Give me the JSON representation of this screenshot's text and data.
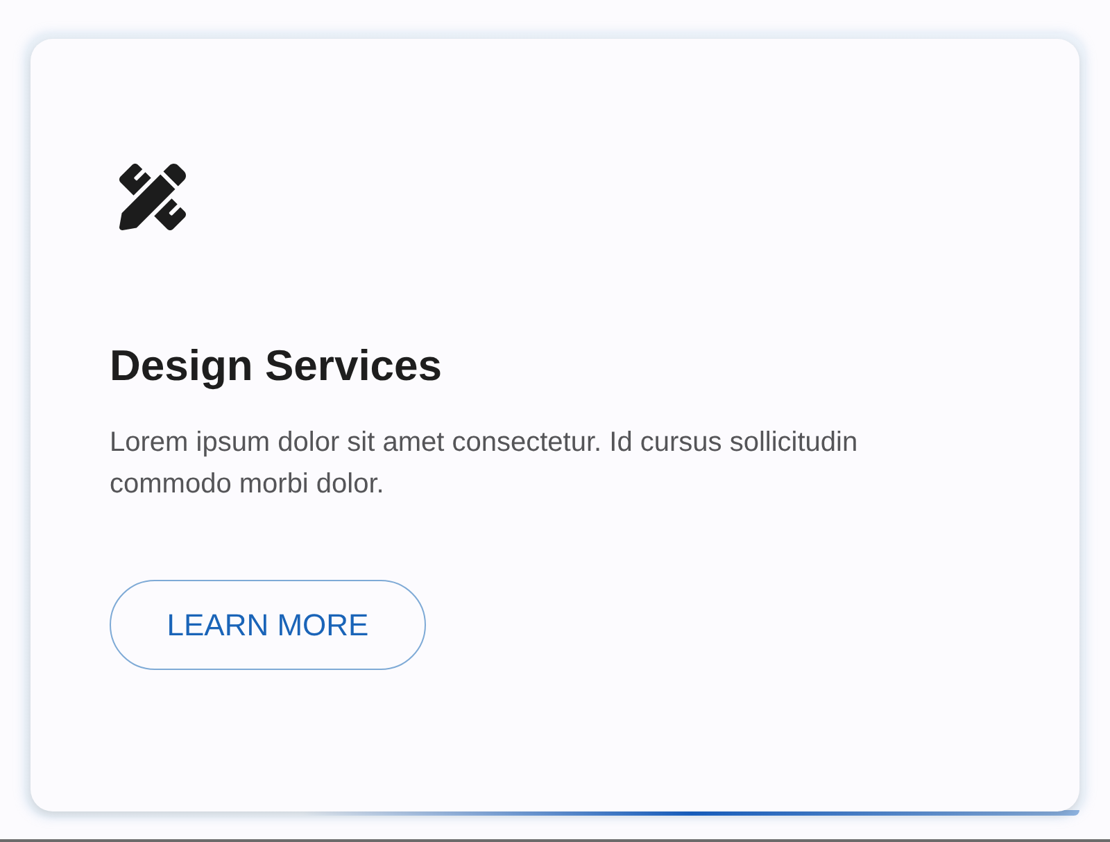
{
  "card": {
    "title": "Design Services",
    "description": "Lorem ipsum dolor sit amet consectetur. Id cursus sollicitudin commodo morbi dolor.",
    "button": {
      "label": "LEARN MORE"
    }
  }
}
